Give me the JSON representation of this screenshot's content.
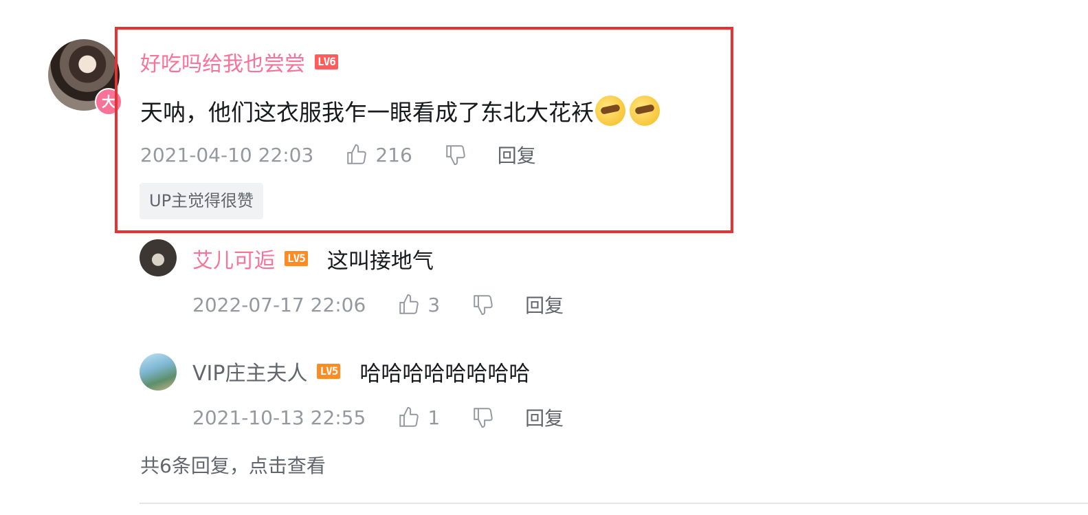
{
  "comment": {
    "username": "好吃吗给我也尝尝",
    "level": "LV6",
    "avatar_badge": "大",
    "text": "天呐，他们这衣服我乍一眼看成了东北大花袄",
    "emojis": [
      "facepalm-emoji",
      "facepalm-emoji"
    ],
    "time": "2021-04-10 22:03",
    "likes": "216",
    "reply_label": "回复",
    "up_tag": "UP主觉得很赞"
  },
  "replies": [
    {
      "username": "艾儿可逅",
      "level": "LV5",
      "text": "这叫接地气",
      "time": "2022-07-17 22:06",
      "likes": "3",
      "reply_label": "回复"
    },
    {
      "username": "VIP庄主夫人",
      "level": "LV5",
      "text": "哈哈哈哈哈哈哈哈",
      "time": "2021-10-13 22:55",
      "likes": "1",
      "reply_label": "回复"
    }
  ],
  "view_more": "共6条回复，点击查看",
  "colors": {
    "username_pink": "#fb7299",
    "lv6_red": "#ff5c5c",
    "lv5_orange": "#ff8b22",
    "highlight_red": "#e63232",
    "meta_gray": "#9499a0"
  }
}
